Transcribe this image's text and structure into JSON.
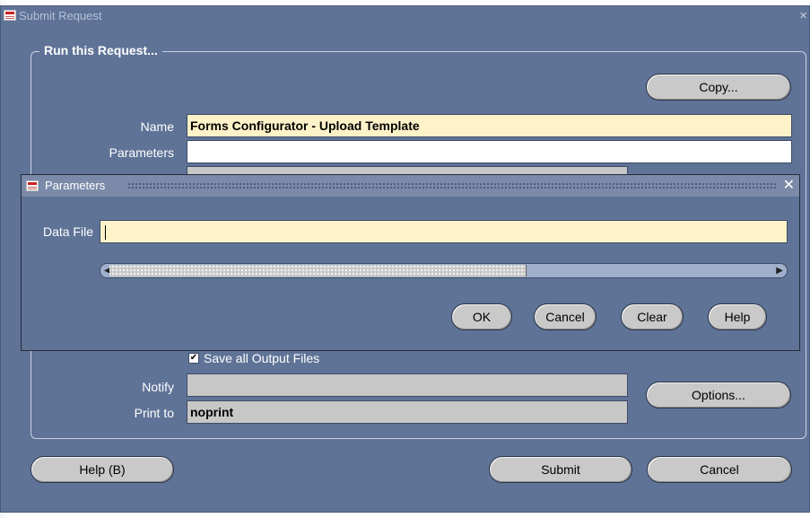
{
  "window": {
    "title": "Submit Request",
    "close_glyph": "×"
  },
  "group": {
    "label": "Run this Request..."
  },
  "copy_button": {
    "label": "Copy..."
  },
  "fields": {
    "name_label": "Name",
    "name_value": "Forms Configurator - Upload Template",
    "parameters_label": "Parameters",
    "parameters_value": "",
    "notify_label": "Notify",
    "notify_value": "",
    "print_to_label": "Print to",
    "print_to_value": "noprint"
  },
  "save_output": {
    "checked": true,
    "label": "Save all Output Files"
  },
  "options_button": {
    "label": "Options..."
  },
  "bottom_buttons": {
    "help": "Help (B)",
    "submit": "Submit",
    "cancel": "Cancel"
  },
  "parameters_dialog": {
    "title": "Parameters",
    "close_glyph": "✕",
    "data_file_label": "Data File",
    "data_file_value": "",
    "buttons": {
      "ok": "OK",
      "cancel": "Cancel",
      "clear": "Clear",
      "help": "Help"
    }
  },
  "colors": {
    "form_background": "#5f7397",
    "required_field": "#fef2c8",
    "button_face": "#c9c9c9"
  }
}
